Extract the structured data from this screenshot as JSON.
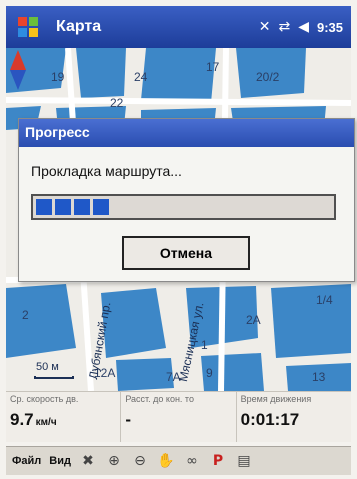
{
  "titlebar": {
    "app_title": "Карта",
    "clock": "9:35"
  },
  "map": {
    "house_labels": [
      "19",
      "24",
      "17",
      "20/2",
      "22",
      "1/4",
      "2",
      "2А",
      "1",
      "7А",
      "9",
      "12А",
      "13"
    ],
    "streets": [
      "Лубянский пр.",
      "Мясницкая ул."
    ],
    "scale_label": "50 м"
  },
  "dialog": {
    "title": "Прогресс",
    "message": "Прокладка маршрута...",
    "progress_fraction": 0.25,
    "cancel_label": "Отмена"
  },
  "info_panel": {
    "speed": {
      "label": "Ср. скорость дв.",
      "value": "9.7",
      "unit": "км/ч"
    },
    "distance": {
      "label": "Расст. до кон. то",
      "value": "-"
    },
    "time": {
      "label": "Время движения",
      "value": "0:01:17"
    }
  },
  "toolbar": {
    "file_label": "Файл",
    "view_label": "Вид"
  },
  "colors": {
    "title_bar": "#1d3d9a",
    "progress_fill": "#1f58c8",
    "buildings": "#3d87c7"
  }
}
